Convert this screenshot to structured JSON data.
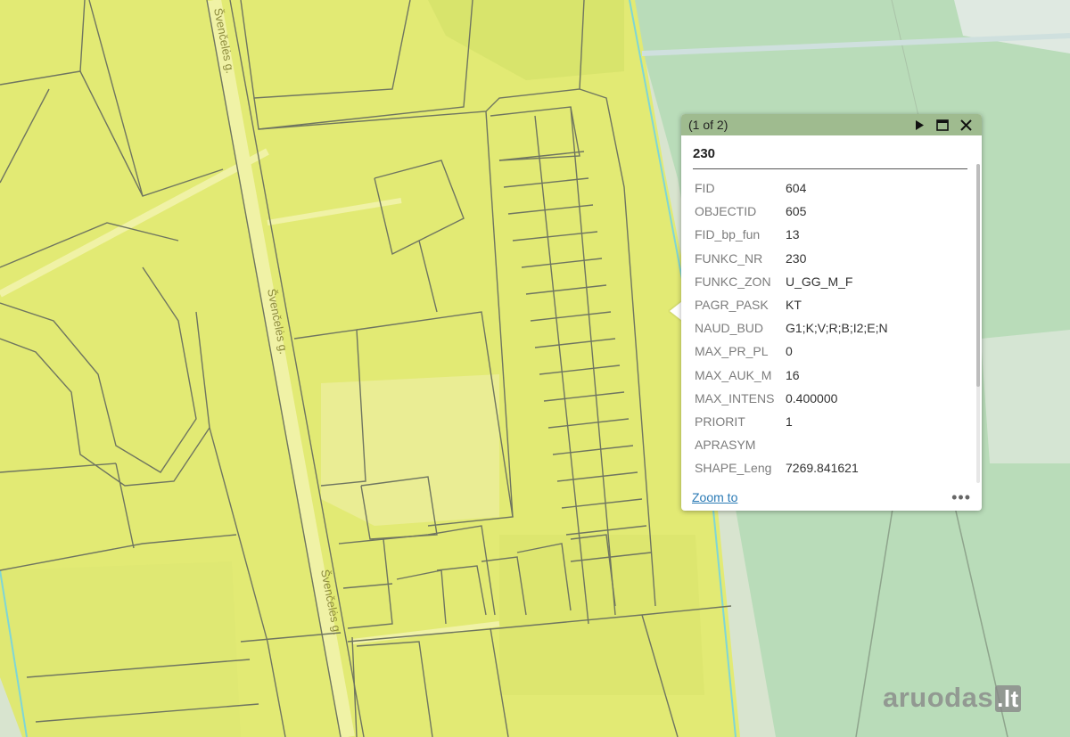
{
  "map": {
    "road_labels": [
      "Švenčelės g.",
      "Švenčelės g.",
      "Švenčelės g."
    ]
  },
  "popup": {
    "counter": "(1 of 2)",
    "title": "230",
    "attributes": [
      {
        "key": "FID",
        "value": "604"
      },
      {
        "key": "OBJECTID",
        "value": "605"
      },
      {
        "key": "FID_bp_fun",
        "value": "13"
      },
      {
        "key": "FUNKC_NR",
        "value": "230"
      },
      {
        "key": "FUNKC_ZON",
        "value": "U_GG_M_F"
      },
      {
        "key": "PAGR_PASK",
        "value": "KT"
      },
      {
        "key": "NAUD_BUD",
        "value": "G1;K;V;R;B;I2;E;N"
      },
      {
        "key": "MAX_PR_PL",
        "value": "0"
      },
      {
        "key": "MAX_AUK_M",
        "value": "16"
      },
      {
        "key": "MAX_INTENS",
        "value": "0.400000"
      },
      {
        "key": "PRIORIT",
        "value": "1"
      },
      {
        "key": "APRASYM",
        "value": ""
      },
      {
        "key": "SHAPE_Leng",
        "value": "7269.841621"
      }
    ],
    "zoom_label": "Zoom to",
    "more_label": "•••",
    "header_icons": [
      "next-icon",
      "maximize-icon",
      "close-icon"
    ]
  },
  "watermark": {
    "name": "aruodas",
    "tld": ".lt"
  },
  "colors": {
    "zone_yellow": "#e2ea74",
    "zone_light": "#e9ec8f",
    "forest_green": "#b9dcb9",
    "popup_header": "#9fbb8f",
    "parcel_line": "#6f7560",
    "link_blue": "#2a7ab5"
  }
}
